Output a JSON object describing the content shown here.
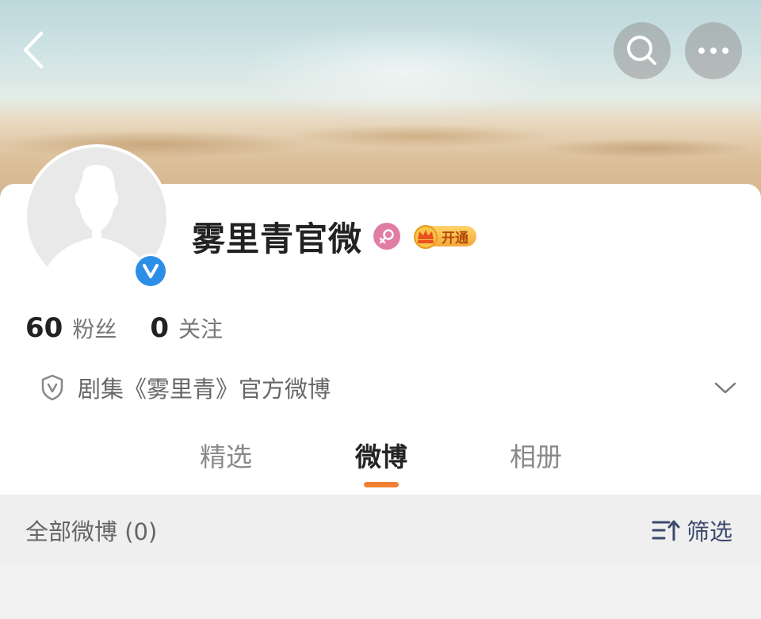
{
  "profile": {
    "name": "雾里青官微",
    "verified": true,
    "gender": "female",
    "vip_label": "开通",
    "bio": "剧集《雾里青》官方微博"
  },
  "stats": {
    "followers_count": "60",
    "followers_label": "粉丝",
    "following_count": "0",
    "following_label": "关注"
  },
  "tabs": [
    {
      "label": "精选",
      "active": false
    },
    {
      "label": "微博",
      "active": true
    },
    {
      "label": "相册",
      "active": false
    }
  ],
  "feed": {
    "header_label": "全部微博 (0)",
    "filter_label": "筛选"
  },
  "icons": {
    "back": "back-chevron-icon",
    "search": "search-icon",
    "more": "more-dots-icon",
    "verified": "verified-v-icon",
    "gender": "female-icon",
    "vip": "crown-icon",
    "bio_shield": "shield-v-icon",
    "expand": "chevron-down-icon",
    "filter": "sort-filter-icon"
  },
  "colors": {
    "accent_orange": "#f08134",
    "verified_blue": "#2d8ee8",
    "gender_pink": "#e17ca3",
    "vip_gold": "#f4a93a",
    "filter_blue": "#3b4a6b"
  }
}
